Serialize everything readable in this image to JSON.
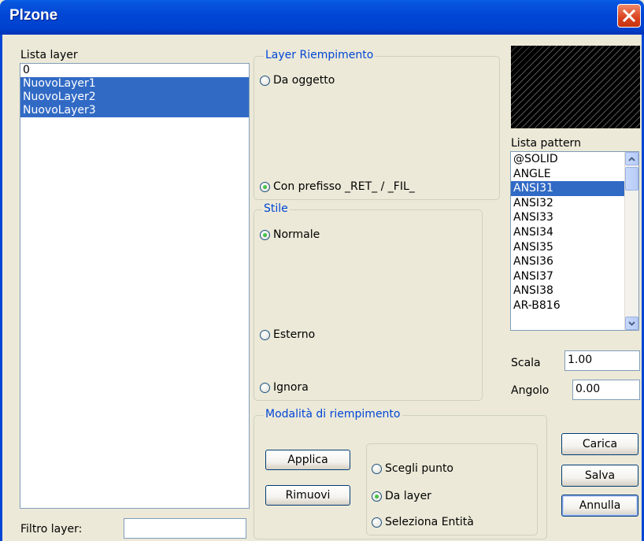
{
  "window": {
    "title": "Plzone"
  },
  "layers": {
    "label": "Lista layer",
    "items": [
      {
        "name": "0",
        "selected": false
      },
      {
        "name": "NuovoLayer1",
        "selected": true
      },
      {
        "name": "NuovoLayer2",
        "selected": true
      },
      {
        "name": "NuovoLayer3",
        "selected": true
      }
    ],
    "filter_label": "Filtro layer:",
    "filter_value": ""
  },
  "layer_fill": {
    "title": "Layer Riempimento",
    "option_object": "Da oggetto",
    "option_prefix": "Con prefisso _RET_ / _FIL_",
    "selected": "prefix"
  },
  "style": {
    "title": "Stile",
    "option_normal": "Normale",
    "option_external": "Esterno",
    "option_ignore": "Ignora",
    "selected": "normal"
  },
  "fill_mode": {
    "title": "Modalità di riempimento",
    "apply_label": "Applica",
    "remove_label": "Rimuovi",
    "option_pick": "Scegli punto",
    "option_layer": "Da layer",
    "option_select": "Seleziona Entità",
    "selected": "layer"
  },
  "patterns": {
    "label": "Lista pattern",
    "items": [
      "@SOLID",
      "ANGLE",
      "ANSI31",
      "ANSI32",
      "ANSI33",
      "ANSI34",
      "ANSI35",
      "ANSI36",
      "ANSI37",
      "ANSI38",
      "AR-B816"
    ],
    "selected_index": 2
  },
  "scale": {
    "label": "Scala",
    "value": "1.00"
  },
  "angle": {
    "label": "Angolo",
    "value": "0.00"
  },
  "buttons": {
    "load": "Carica",
    "save": "Salva",
    "cancel": "Annulla"
  },
  "icons": {
    "close": "close-icon",
    "scroll_up": "chevron-up-icon",
    "scroll_down": "chevron-down-icon"
  },
  "colors": {
    "accent": "#0046d5",
    "selection": "#316AC5",
    "close": "#d9421e"
  }
}
